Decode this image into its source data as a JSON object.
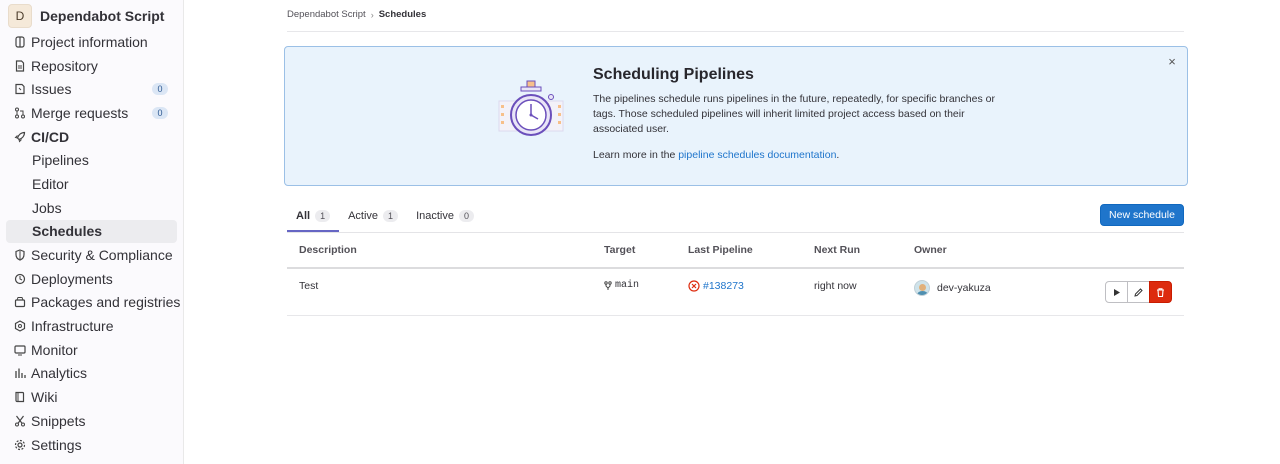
{
  "project": {
    "avatar_letter": "D",
    "name": "Dependabot Script"
  },
  "sidebar": {
    "items": [
      {
        "label": "Project information",
        "icon": "project-icon"
      },
      {
        "label": "Repository",
        "icon": "doc-icon"
      },
      {
        "label": "Issues",
        "icon": "issues-icon",
        "count": "0"
      },
      {
        "label": "Merge requests",
        "icon": "merge-request-icon",
        "count": "0"
      },
      {
        "label": "CI/CD",
        "icon": "rocket-icon"
      },
      {
        "label": "Pipelines"
      },
      {
        "label": "Editor"
      },
      {
        "label": "Jobs"
      },
      {
        "label": "Schedules"
      },
      {
        "label": "Security & Compliance",
        "icon": "shield-icon"
      },
      {
        "label": "Deployments",
        "icon": "deployments-icon"
      },
      {
        "label": "Packages and registries",
        "icon": "package-icon"
      },
      {
        "label": "Infrastructure",
        "icon": "infrastructure-icon"
      },
      {
        "label": "Monitor",
        "icon": "monitor-icon"
      },
      {
        "label": "Analytics",
        "icon": "chart-icon"
      },
      {
        "label": "Wiki",
        "icon": "book-icon"
      },
      {
        "label": "Snippets",
        "icon": "snippet-icon"
      },
      {
        "label": "Settings",
        "icon": "gear-icon"
      }
    ]
  },
  "breadcrumb": {
    "parent": "Dependabot Script",
    "separator": "›",
    "current": "Schedules"
  },
  "alert": {
    "title": "Scheduling Pipelines",
    "body": "The pipelines schedule runs pipelines in the future, repeatedly, for specific branches or tags. Those scheduled pipelines will inherit limited project access based on their associated user.",
    "learn_prefix": "Learn more in the ",
    "learn_link": "pipeline schedules documentation",
    "learn_suffix": ".",
    "close": "×"
  },
  "tabs": [
    {
      "label": "All",
      "count": "1"
    },
    {
      "label": "Active",
      "count": "1"
    },
    {
      "label": "Inactive",
      "count": "0"
    }
  ],
  "new_schedule_label": "New schedule",
  "table": {
    "headers": {
      "description": "Description",
      "target": "Target",
      "last_pipeline": "Last Pipeline",
      "next_run": "Next Run",
      "owner": "Owner"
    },
    "rows": [
      {
        "description": "Test",
        "target": "main",
        "last_pipeline": "#138273",
        "next_run": "right now",
        "owner": "dev-yakuza"
      }
    ]
  },
  "colors": {
    "primary": "#1f75cb",
    "danger": "#dd2b0e",
    "alert_bg": "#e9f3fc",
    "tab_active": "#6666c4"
  }
}
